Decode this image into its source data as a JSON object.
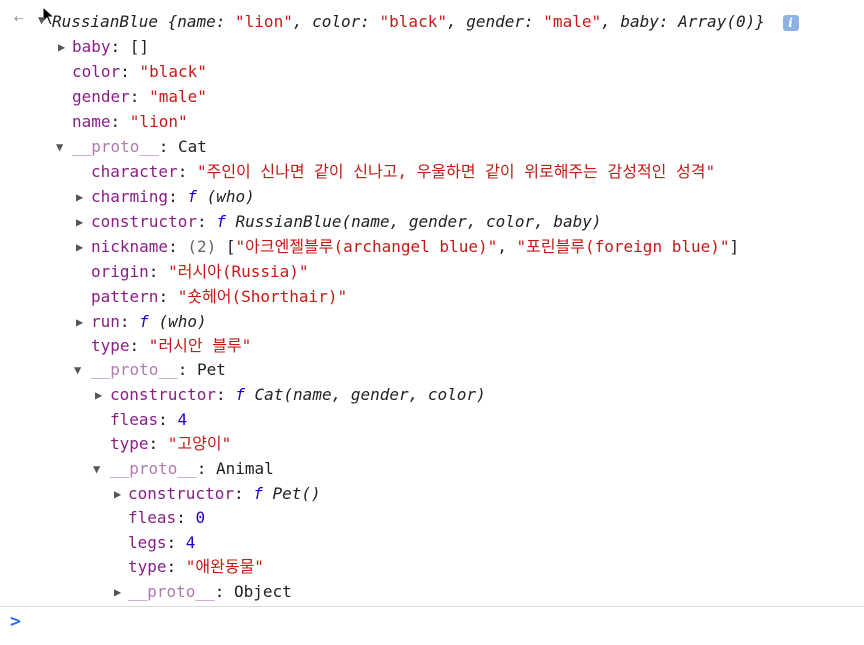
{
  "header": {
    "back_glyph": "⇠",
    "object_class": "RussianBlue",
    "summary": [
      {
        "k": "name",
        "v": "\"lion\""
      },
      {
        "k": "color",
        "v": "\"black\""
      },
      {
        "k": "gender",
        "v": "\"male\""
      },
      {
        "k": "baby",
        "v": "Array(0)"
      }
    ],
    "info_glyph": "i"
  },
  "props": {
    "baby": {
      "k": "baby",
      "v": "[]"
    },
    "color": {
      "k": "color",
      "v": "\"black\""
    },
    "gender": {
      "k": "gender",
      "v": "\"male\""
    },
    "name": {
      "k": "name",
      "v": "\"lion\""
    },
    "proto_cat": {
      "k": "__proto__",
      "v": "Cat"
    }
  },
  "cat": {
    "character": {
      "k": "character",
      "v": "\"주인이 신나면 같이 신나고, 우울하면 같이 위로해주는 감성적인 성격\""
    },
    "charming": {
      "k": "charming",
      "f": "f",
      "sig": "(who)"
    },
    "constructor": {
      "k": "constructor",
      "f": "f",
      "sig": "RussianBlue(name, gender, color, baby)"
    },
    "nickname": {
      "k": "nickname",
      "count": "(2)",
      "open": "[",
      "a": "\"아크엔젤블루(archangel blue)\"",
      "b": "\"포린블루(foreign blue)\"",
      "close": "]"
    },
    "origin": {
      "k": "origin",
      "v": "\"러시아(Russia)\""
    },
    "pattern": {
      "k": "pattern",
      "v": "\"숏헤어(Shorthair)\""
    },
    "run": {
      "k": "run",
      "f": "f",
      "sig": "(who)"
    },
    "type": {
      "k": "type",
      "v": "\"러시안 블루\""
    },
    "proto_pet": {
      "k": "__proto__",
      "v": "Pet"
    }
  },
  "pet": {
    "constructor": {
      "k": "constructor",
      "f": "f",
      "sig": "Cat(name, gender, color)"
    },
    "fleas": {
      "k": "fleas",
      "v": "4"
    },
    "type": {
      "k": "type",
      "v": "\"고양이\""
    },
    "proto_animal": {
      "k": "__proto__",
      "v": "Animal"
    }
  },
  "animal": {
    "constructor": {
      "k": "constructor",
      "f": "f",
      "sig": "Pet()"
    },
    "fleas": {
      "k": "fleas",
      "v": "0"
    },
    "legs": {
      "k": "legs",
      "v": "4"
    },
    "type": {
      "k": "type",
      "v": "\"애완동물\""
    },
    "proto_object": {
      "k": "__proto__",
      "v": "Object"
    }
  },
  "console": {
    "prompt_glyph": ">"
  }
}
